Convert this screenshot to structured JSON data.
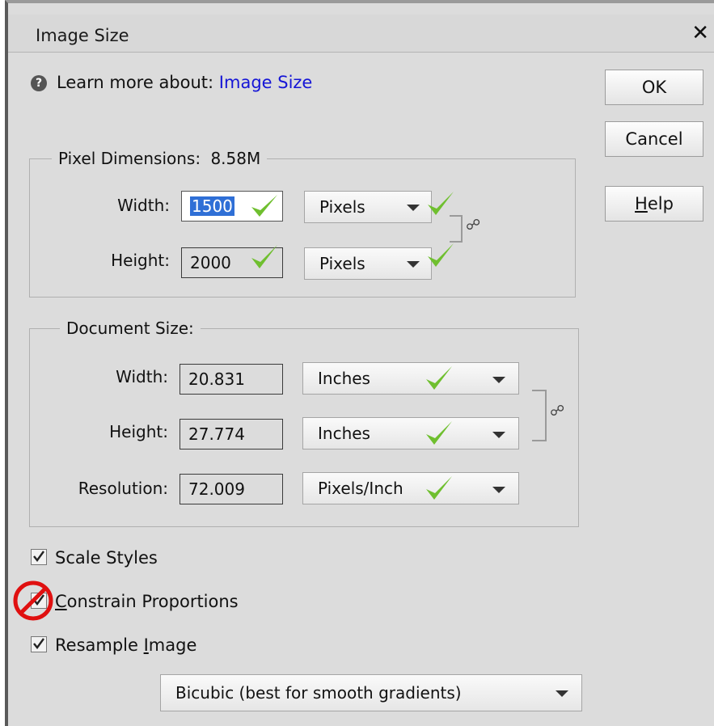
{
  "dialog": {
    "title": "Image Size",
    "close_glyph": "✕"
  },
  "learn_more": {
    "prefix": "Learn more about:",
    "link": "Image Size",
    "icon": "help-circle-icon"
  },
  "buttons": {
    "ok": "OK",
    "cancel": "Cancel",
    "help_first": "H",
    "help_rest": "elp"
  },
  "pixel_dimensions": {
    "legend_label": "Pixel Dimensions:",
    "legend_value": "8.58M",
    "width": {
      "label": "Width:",
      "value": "1500",
      "unit": "Pixels"
    },
    "height": {
      "label": "Height:",
      "value": "2000",
      "unit": "Pixels"
    }
  },
  "document_size": {
    "legend": "Document Size:",
    "width": {
      "label": "Width:",
      "value": "20.831",
      "unit": "Inches"
    },
    "height": {
      "label": "Height:",
      "value": "27.774",
      "unit": "Inches"
    },
    "resolution": {
      "label": "Resolution:",
      "value": "72.009",
      "unit": "Pixels/Inch"
    }
  },
  "checkboxes": {
    "scale_styles": {
      "label": "Scale Styles",
      "checked": true
    },
    "constrain": {
      "first": "C",
      "rest": "onstrain Proportions",
      "checked": true,
      "annotation": "prohibited-sign-icon"
    },
    "resample": {
      "pre": "Resample ",
      "first": "I",
      "rest": "mage",
      "checked": true
    }
  },
  "resample_method": "Bicubic (best for smooth gradients)",
  "colors": {
    "accent_link": "#1515d6",
    "checkmark": "#6fbf2f",
    "prohibit": "#e01010",
    "selection": "#2f6fd6"
  }
}
